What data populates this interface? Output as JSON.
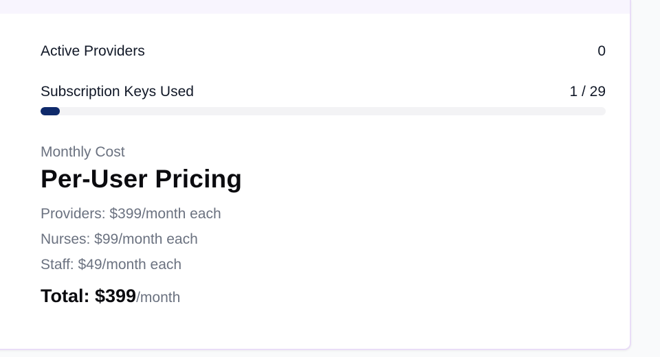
{
  "stats": {
    "active_providers_label": "Active Providers",
    "active_providers_value": "0",
    "subscription_keys_label": "Subscription Keys Used",
    "subscription_keys_value": "1 / 29",
    "subscription_keys_used": 1,
    "subscription_keys_total": 29
  },
  "pricing": {
    "section_label": "Monthly Cost",
    "title": "Per-User Pricing",
    "lines": [
      "Providers: $399/month each",
      "Nurses: $99/month each",
      "Staff: $49/month each"
    ],
    "total_label": "Total: $399",
    "total_suffix": "/month"
  },
  "colors": {
    "progress_fill": "#0f2a6b",
    "progress_track": "#f3f3f5",
    "card_border": "#e9ddf7"
  }
}
